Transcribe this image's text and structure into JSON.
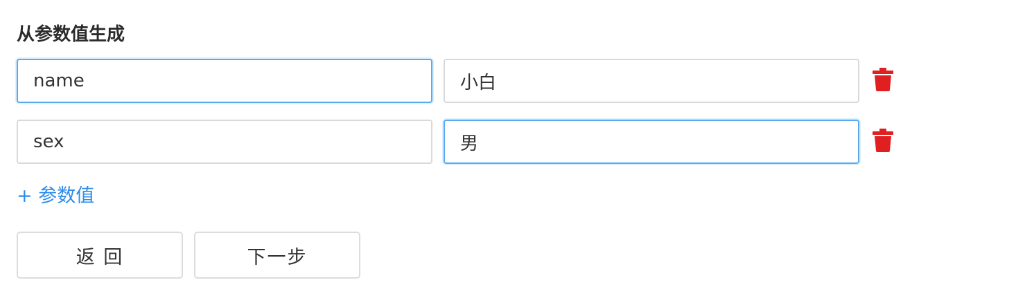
{
  "section": {
    "title": "从参数值生成"
  },
  "params": [
    {
      "key": "name",
      "value": "小白"
    },
    {
      "key": "sex",
      "value": "男"
    }
  ],
  "add_param": {
    "label": "+ 参数值"
  },
  "buttons": {
    "back_label": "返 回",
    "next_label": "下一步"
  },
  "colors": {
    "accent": "#2d8ceb",
    "focus_border": "#5aaaf0",
    "delete": "#e02020",
    "border": "#d9d9d9"
  },
  "icons": {
    "delete": "trash-icon"
  }
}
